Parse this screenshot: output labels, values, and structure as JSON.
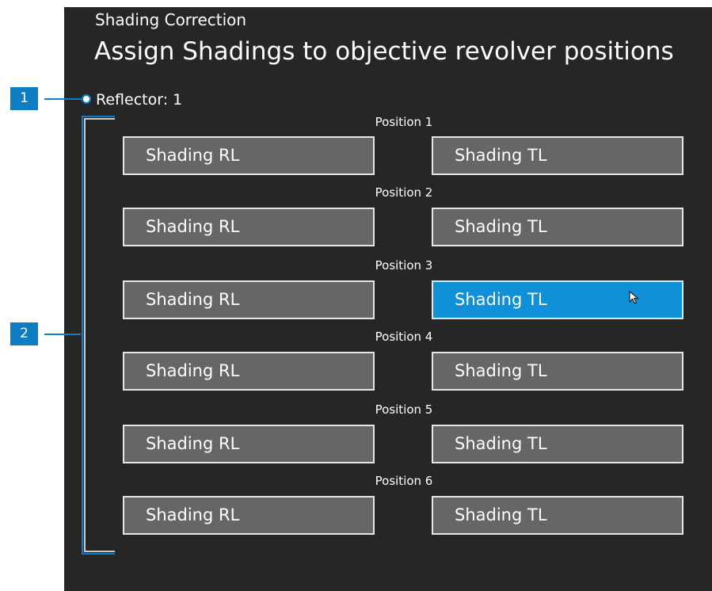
{
  "header": {
    "subtitle": "Shading Correction",
    "title": "Assign Shadings to objective revolver positions"
  },
  "reflector": {
    "label": "Reflector: 1"
  },
  "positions": [
    {
      "label": "Position 1",
      "left": "Shading RL",
      "right": "Shading TL"
    },
    {
      "label": "Position 2",
      "left": "Shading RL",
      "right": "Shading TL"
    },
    {
      "label": "Position 3",
      "left": "Shading RL",
      "right": "Shading TL",
      "selected": "right"
    },
    {
      "label": "Position 4",
      "left": "Shading RL",
      "right": "Shading TL"
    },
    {
      "label": "Position 5",
      "left": "Shading RL",
      "right": "Shading TL"
    },
    {
      "label": "Position 6",
      "left": "Shading RL",
      "right": "Shading TL"
    }
  ],
  "callouts": {
    "c1": "1",
    "c2": "2"
  },
  "colors": {
    "panel_bg": "#262626",
    "button_bg": "#666666",
    "selected_bg": "#0f90d8",
    "callout_bg": "#0e7dc3"
  },
  "icons": {
    "cursor": "mouse-pointer-icon"
  }
}
